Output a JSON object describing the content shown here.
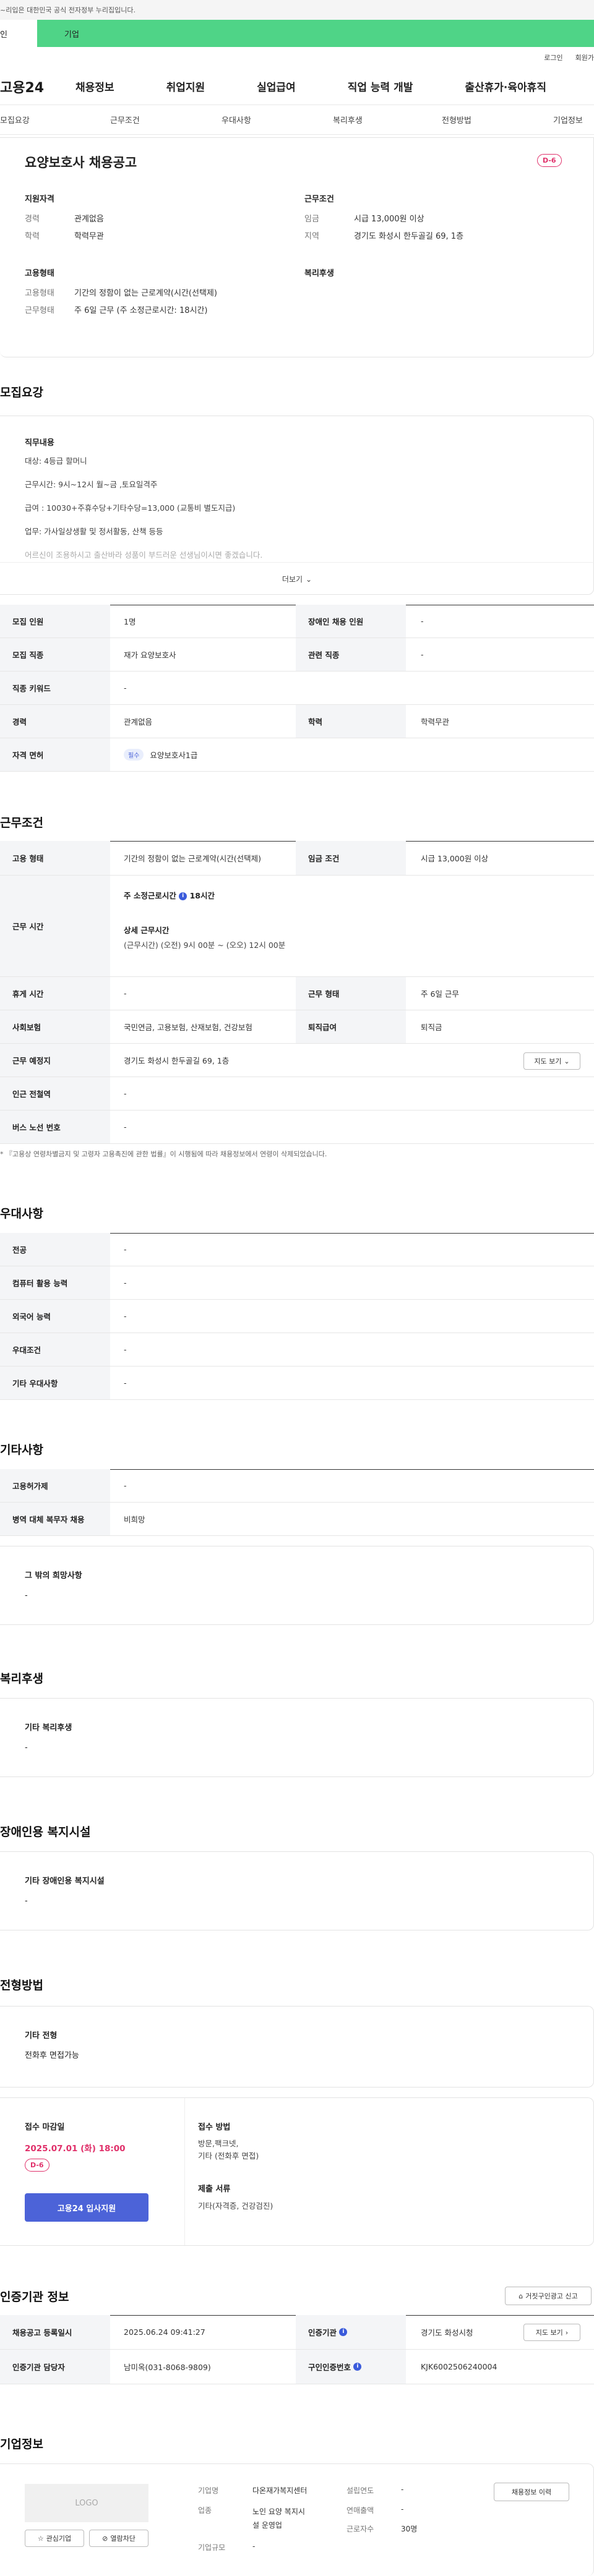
{
  "banner": {
    "text": "~리입은 대한민국 공식 전자정부 누리집입니다."
  },
  "top_tabs": {
    "individual": "인",
    "company": "기업"
  },
  "util": {
    "login": "로그인",
    "signup": "회원가"
  },
  "gnb": {
    "logo": "고용24",
    "menu": [
      "채용정보",
      "취업지원",
      "실업급여",
      "직업 능력 개발",
      "출산휴가·육아휴직"
    ]
  },
  "anchor_nav": [
    "모집요강",
    "근무조건",
    "우대사항",
    "복리후생",
    "전형방법",
    "기업정보"
  ],
  "head": {
    "title": "요양보호사 채용공고",
    "dday": "D-6",
    "qual_title": "지원자격",
    "qual": [
      {
        "label": "경력",
        "value": "관계없음"
      },
      {
        "label": "학력",
        "value": "학력무관"
      }
    ],
    "cond_title": "근무조건",
    "cond": [
      {
        "label": "임금",
        "value": "시급 13,000원 이상"
      },
      {
        "label": "지역",
        "value": "경기도 화성시 한두골길 69, 1층"
      }
    ],
    "emp_title": "고용형태",
    "emp": [
      {
        "label": "고용형태",
        "value": "기간의 정함이 없는 근로계약(시간(선택제)"
      },
      {
        "label": "근무형태",
        "value": "주 6일 근무 (주 소정근로시간: 18시간)"
      }
    ],
    "welfare_title": "복리후생"
  },
  "recruit": {
    "title": "모집요강",
    "duty_title": "직무내용",
    "duty_lines": [
      "대상: 4등급 할머니",
      "근무시간: 9시~12시 월~금 ,토요일격주",
      "급여 : 10030+주휴수당+기타수당=13,000 (교통비 별도지급)",
      "업무: 가사일상생활 및 정서활동, 산책 등등",
      "어르신이 조용하시고 출산바라 성품이 부드러운 선생님이시면 좋겠습니다."
    ],
    "more": "더보기",
    "rows": [
      {
        "l1": "모집 인원",
        "v1": "1명",
        "l2": "장애인 채용 인원",
        "v2": "-"
      },
      {
        "l1": "모집 직종",
        "v1": "재가 요양보호사",
        "l2": "관련 직종",
        "v2": "-"
      },
      {
        "l1": "직종 키워드",
        "v1": "-"
      },
      {
        "l1": "경력",
        "v1": "관계없음",
        "l2": "학력",
        "v2": "학력무관"
      },
      {
        "l1": "자격 면허",
        "badge": "필수",
        "v1": "요양보호사1급"
      }
    ]
  },
  "work": {
    "title": "근무조건",
    "emp_label": "고용 형태",
    "emp_value": "기간의 정함이 없는 근로계약(시간(선택제)",
    "wage_label": "임금 조건",
    "wage_value": "시급 13,000원 이상",
    "hours_label": "근무 시간",
    "hours_week": "주 소정근로시간",
    "hours_week_val": "18시간",
    "hours_detail_title": "상세 근무시간",
    "hours_detail": "(근무시간) (오전) 9시 00분 ~ (오오) 12시 00분",
    "rest_label": "휴게 시간",
    "rest_value": "-",
    "form_label": "근무 형태",
    "form_value": "주 6일 근무",
    "ins_label": "사회보험",
    "ins_value": "국민연금, 고용보험, 산재보험, 건강보험",
    "retire_label": "퇴직급여",
    "retire_value": "퇴직금",
    "place_label": "근무 예정지",
    "place_value": "경기도 화성시 한두골길 69, 1층",
    "map_btn": "지도 보기",
    "subway_label": "인근 전철역",
    "subway_value": "-",
    "bus_label": "버스 노선 번호",
    "bus_value": "-",
    "note": "* 『고용상 연령차별금지 및 고령자 고용촉진에 관한 법률』이 시행됨에 따라 채용정보에서 연령이 삭제되었습니다."
  },
  "pref": {
    "title": "우대사항",
    "rows": [
      {
        "label": "전공",
        "value": "-"
      },
      {
        "label": "컴퓨터 활용 능력",
        "value": "-"
      },
      {
        "label": "외국어 능력",
        "value": "-"
      },
      {
        "label": "우대조건",
        "value": "-"
      },
      {
        "label": "기타 우대사항",
        "value": "-"
      }
    ]
  },
  "etc": {
    "title": "기타사항",
    "rows": [
      {
        "label": "고용허가제",
        "value": "-"
      },
      {
        "label": "병역 대체 복무자 채용",
        "value": "비희망"
      }
    ],
    "other_title": "그 밖의 희망사항",
    "other_value": "-"
  },
  "welfare": {
    "title": "복리후생",
    "box_title": "기타 복리후생",
    "box_value": "-"
  },
  "disabled": {
    "title": "장애인용 복지시설",
    "box_title": "기타 장애인용 복지시설",
    "box_value": "-"
  },
  "selection": {
    "title": "전형방법",
    "box_title": "기타 전형",
    "box_value": "전화후 면접가능",
    "deadline_title": "접수 마감일",
    "deadline": "2025.07.01 (화) 18:00",
    "dday": "D-6",
    "method_title": "접수 방법",
    "method_value": "방문,팩크넷,\n기타 (전화후 면접)",
    "docs_title": "제출 서류",
    "docs_value": "기타(자격증, 건강검진)",
    "apply_btn": "고용24 입사지원"
  },
  "cert": {
    "title": "인증기관 정보",
    "report_btn": "거짓구인광고 신고",
    "row1_l1": "채용공고 등록일시",
    "row1_v1": "2025.06.24 09:41:27",
    "row1_l2": "인증기관",
    "row1_v2": "경기도 화성시청",
    "map_btn": "지도 보기",
    "row2_l1": "인증기관 담당자",
    "row2_v1": "남미옥(031-8068-9809)",
    "row2_l2": "구인인증번호",
    "row2_v2": "KJK6002506240004"
  },
  "company": {
    "title": "기업정보",
    "logo": "LOGO",
    "fav_btn": "관심기업",
    "hide_btn": "열람차단",
    "name_label": "기업명",
    "name_value": "다온재가복지센터",
    "type_label": "업종",
    "type_value": "노인 요양 복지시\n설 운영업",
    "size_label": "기업규모",
    "size_value": "-",
    "founded_label": "설립연도",
    "founded_value": "-",
    "sales_label": "연매출액",
    "sales_value": "-",
    "staff_label": "근로자수",
    "staff_value": "30명",
    "history_btn": "채용정보 이력"
  }
}
